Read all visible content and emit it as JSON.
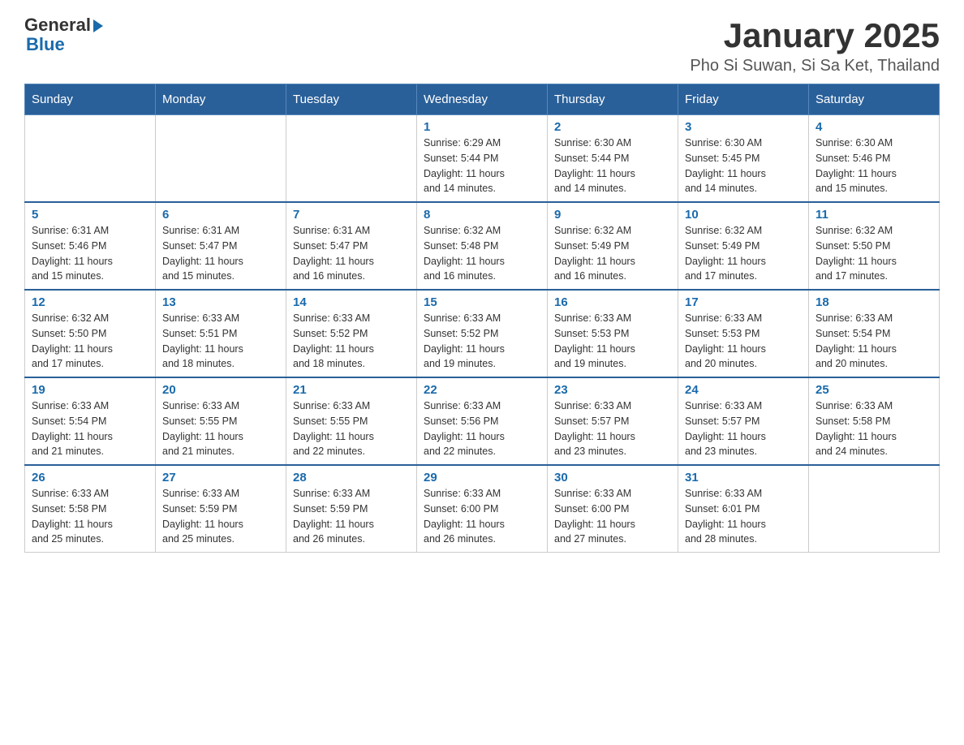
{
  "header": {
    "logo_general": "General",
    "logo_blue": "Blue",
    "title": "January 2025",
    "subtitle": "Pho Si Suwan, Si Sa Ket, Thailand"
  },
  "days_of_week": [
    "Sunday",
    "Monday",
    "Tuesday",
    "Wednesday",
    "Thursday",
    "Friday",
    "Saturday"
  ],
  "weeks": [
    {
      "days": [
        {
          "num": "",
          "info": ""
        },
        {
          "num": "",
          "info": ""
        },
        {
          "num": "",
          "info": ""
        },
        {
          "num": "1",
          "info": "Sunrise: 6:29 AM\nSunset: 5:44 PM\nDaylight: 11 hours\nand 14 minutes."
        },
        {
          "num": "2",
          "info": "Sunrise: 6:30 AM\nSunset: 5:44 PM\nDaylight: 11 hours\nand 14 minutes."
        },
        {
          "num": "3",
          "info": "Sunrise: 6:30 AM\nSunset: 5:45 PM\nDaylight: 11 hours\nand 14 minutes."
        },
        {
          "num": "4",
          "info": "Sunrise: 6:30 AM\nSunset: 5:46 PM\nDaylight: 11 hours\nand 15 minutes."
        }
      ]
    },
    {
      "days": [
        {
          "num": "5",
          "info": "Sunrise: 6:31 AM\nSunset: 5:46 PM\nDaylight: 11 hours\nand 15 minutes."
        },
        {
          "num": "6",
          "info": "Sunrise: 6:31 AM\nSunset: 5:47 PM\nDaylight: 11 hours\nand 15 minutes."
        },
        {
          "num": "7",
          "info": "Sunrise: 6:31 AM\nSunset: 5:47 PM\nDaylight: 11 hours\nand 16 minutes."
        },
        {
          "num": "8",
          "info": "Sunrise: 6:32 AM\nSunset: 5:48 PM\nDaylight: 11 hours\nand 16 minutes."
        },
        {
          "num": "9",
          "info": "Sunrise: 6:32 AM\nSunset: 5:49 PM\nDaylight: 11 hours\nand 16 minutes."
        },
        {
          "num": "10",
          "info": "Sunrise: 6:32 AM\nSunset: 5:49 PM\nDaylight: 11 hours\nand 17 minutes."
        },
        {
          "num": "11",
          "info": "Sunrise: 6:32 AM\nSunset: 5:50 PM\nDaylight: 11 hours\nand 17 minutes."
        }
      ]
    },
    {
      "days": [
        {
          "num": "12",
          "info": "Sunrise: 6:32 AM\nSunset: 5:50 PM\nDaylight: 11 hours\nand 17 minutes."
        },
        {
          "num": "13",
          "info": "Sunrise: 6:33 AM\nSunset: 5:51 PM\nDaylight: 11 hours\nand 18 minutes."
        },
        {
          "num": "14",
          "info": "Sunrise: 6:33 AM\nSunset: 5:52 PM\nDaylight: 11 hours\nand 18 minutes."
        },
        {
          "num": "15",
          "info": "Sunrise: 6:33 AM\nSunset: 5:52 PM\nDaylight: 11 hours\nand 19 minutes."
        },
        {
          "num": "16",
          "info": "Sunrise: 6:33 AM\nSunset: 5:53 PM\nDaylight: 11 hours\nand 19 minutes."
        },
        {
          "num": "17",
          "info": "Sunrise: 6:33 AM\nSunset: 5:53 PM\nDaylight: 11 hours\nand 20 minutes."
        },
        {
          "num": "18",
          "info": "Sunrise: 6:33 AM\nSunset: 5:54 PM\nDaylight: 11 hours\nand 20 minutes."
        }
      ]
    },
    {
      "days": [
        {
          "num": "19",
          "info": "Sunrise: 6:33 AM\nSunset: 5:54 PM\nDaylight: 11 hours\nand 21 minutes."
        },
        {
          "num": "20",
          "info": "Sunrise: 6:33 AM\nSunset: 5:55 PM\nDaylight: 11 hours\nand 21 minutes."
        },
        {
          "num": "21",
          "info": "Sunrise: 6:33 AM\nSunset: 5:55 PM\nDaylight: 11 hours\nand 22 minutes."
        },
        {
          "num": "22",
          "info": "Sunrise: 6:33 AM\nSunset: 5:56 PM\nDaylight: 11 hours\nand 22 minutes."
        },
        {
          "num": "23",
          "info": "Sunrise: 6:33 AM\nSunset: 5:57 PM\nDaylight: 11 hours\nand 23 minutes."
        },
        {
          "num": "24",
          "info": "Sunrise: 6:33 AM\nSunset: 5:57 PM\nDaylight: 11 hours\nand 23 minutes."
        },
        {
          "num": "25",
          "info": "Sunrise: 6:33 AM\nSunset: 5:58 PM\nDaylight: 11 hours\nand 24 minutes."
        }
      ]
    },
    {
      "days": [
        {
          "num": "26",
          "info": "Sunrise: 6:33 AM\nSunset: 5:58 PM\nDaylight: 11 hours\nand 25 minutes."
        },
        {
          "num": "27",
          "info": "Sunrise: 6:33 AM\nSunset: 5:59 PM\nDaylight: 11 hours\nand 25 minutes."
        },
        {
          "num": "28",
          "info": "Sunrise: 6:33 AM\nSunset: 5:59 PM\nDaylight: 11 hours\nand 26 minutes."
        },
        {
          "num": "29",
          "info": "Sunrise: 6:33 AM\nSunset: 6:00 PM\nDaylight: 11 hours\nand 26 minutes."
        },
        {
          "num": "30",
          "info": "Sunrise: 6:33 AM\nSunset: 6:00 PM\nDaylight: 11 hours\nand 27 minutes."
        },
        {
          "num": "31",
          "info": "Sunrise: 6:33 AM\nSunset: 6:01 PM\nDaylight: 11 hours\nand 28 minutes."
        },
        {
          "num": "",
          "info": ""
        }
      ]
    }
  ]
}
